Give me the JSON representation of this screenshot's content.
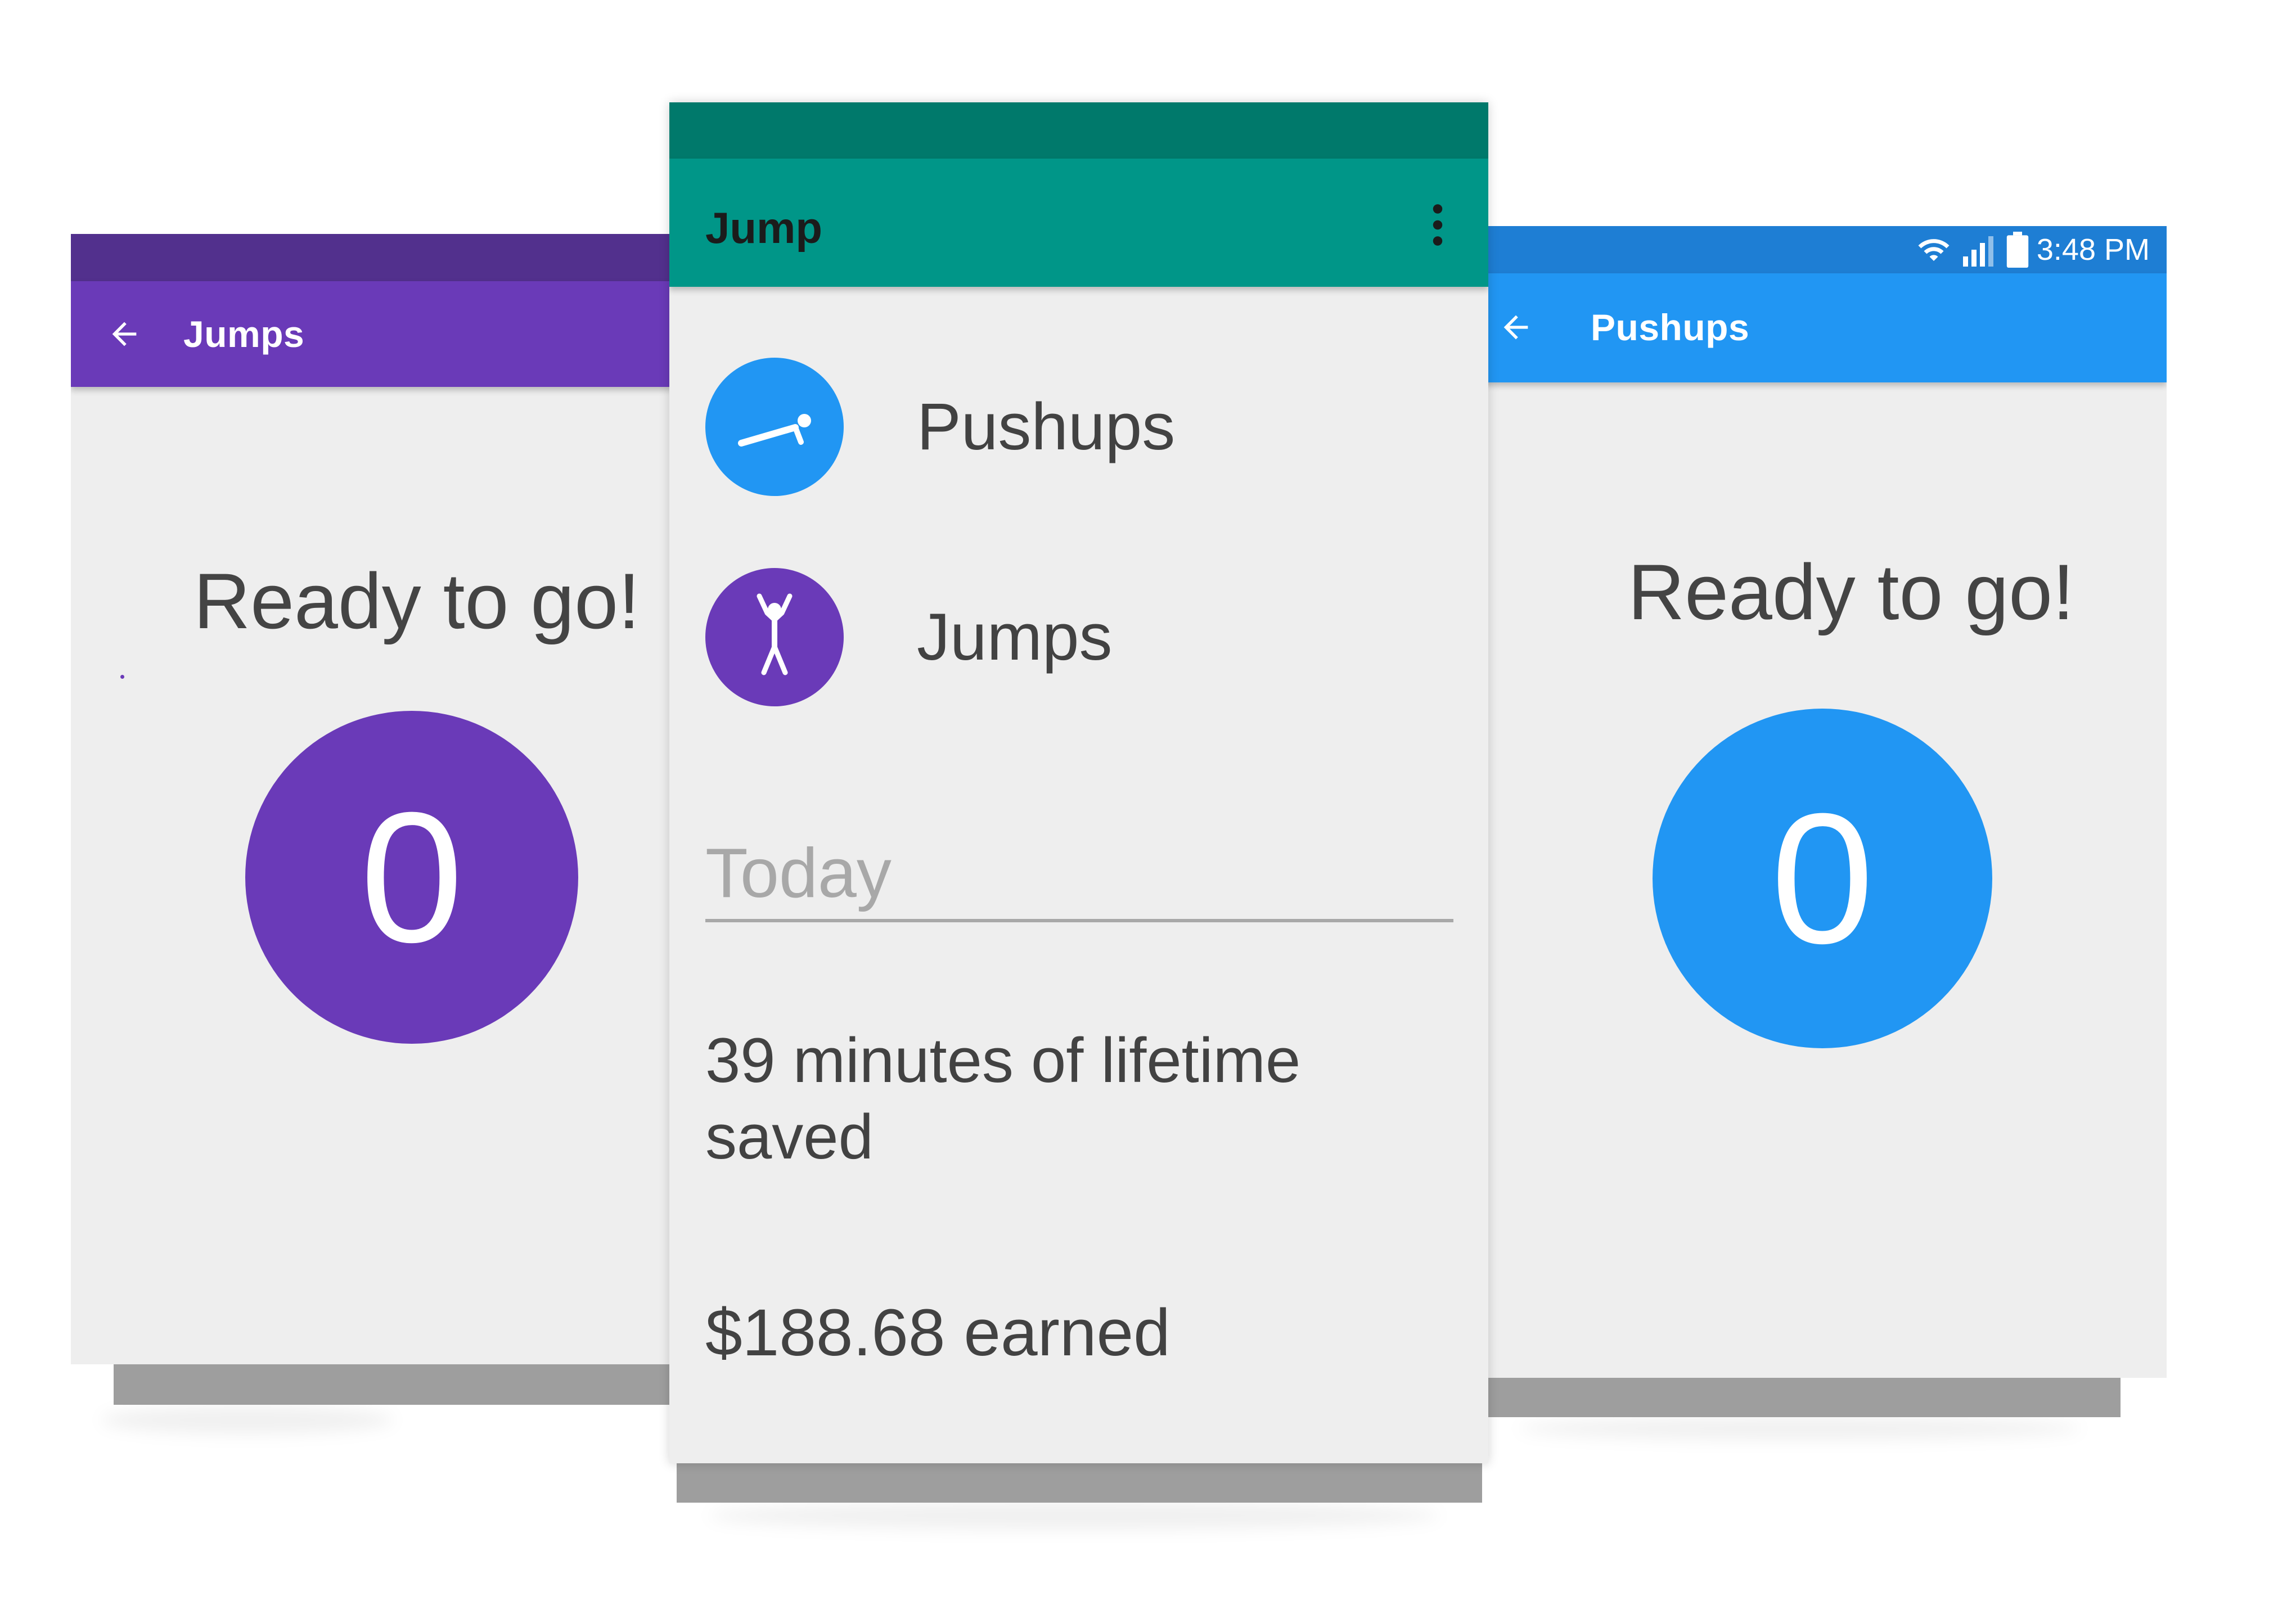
{
  "colors": {
    "jumps_primary": "#6a3ab8",
    "jumps_dark": "#52308d",
    "pushups_primary": "#2196f3",
    "pushups_dark": "#1e7ed4",
    "main_primary": "#009688",
    "main_dark": "#00796b",
    "background": "#eeeeee"
  },
  "left_screen": {
    "app_bar": {
      "title": "Jumps",
      "back_icon": "arrow-back-icon"
    },
    "status_message": "Ready to go!",
    "counter": "0"
  },
  "center_screen": {
    "app_bar": {
      "title": "Jump",
      "menu_icon": "more-vert-icon"
    },
    "exercises": [
      {
        "label": "Pushups",
        "icon": "pushup-figure-icon"
      },
      {
        "label": "Jumps",
        "icon": "jumping-figure-icon"
      }
    ],
    "section_header": "Today",
    "lifetime_saved": "39 minutes of lifetime saved",
    "earned": "$188.68 earned"
  },
  "right_screen": {
    "status_bar": {
      "time": "3:48 PM",
      "icons": [
        "wifi-icon",
        "signal-icon",
        "battery-icon"
      ]
    },
    "app_bar": {
      "title": "Pushups",
      "back_icon": "arrow-back-icon"
    },
    "status_message": "Ready to go!",
    "counter": "0"
  }
}
